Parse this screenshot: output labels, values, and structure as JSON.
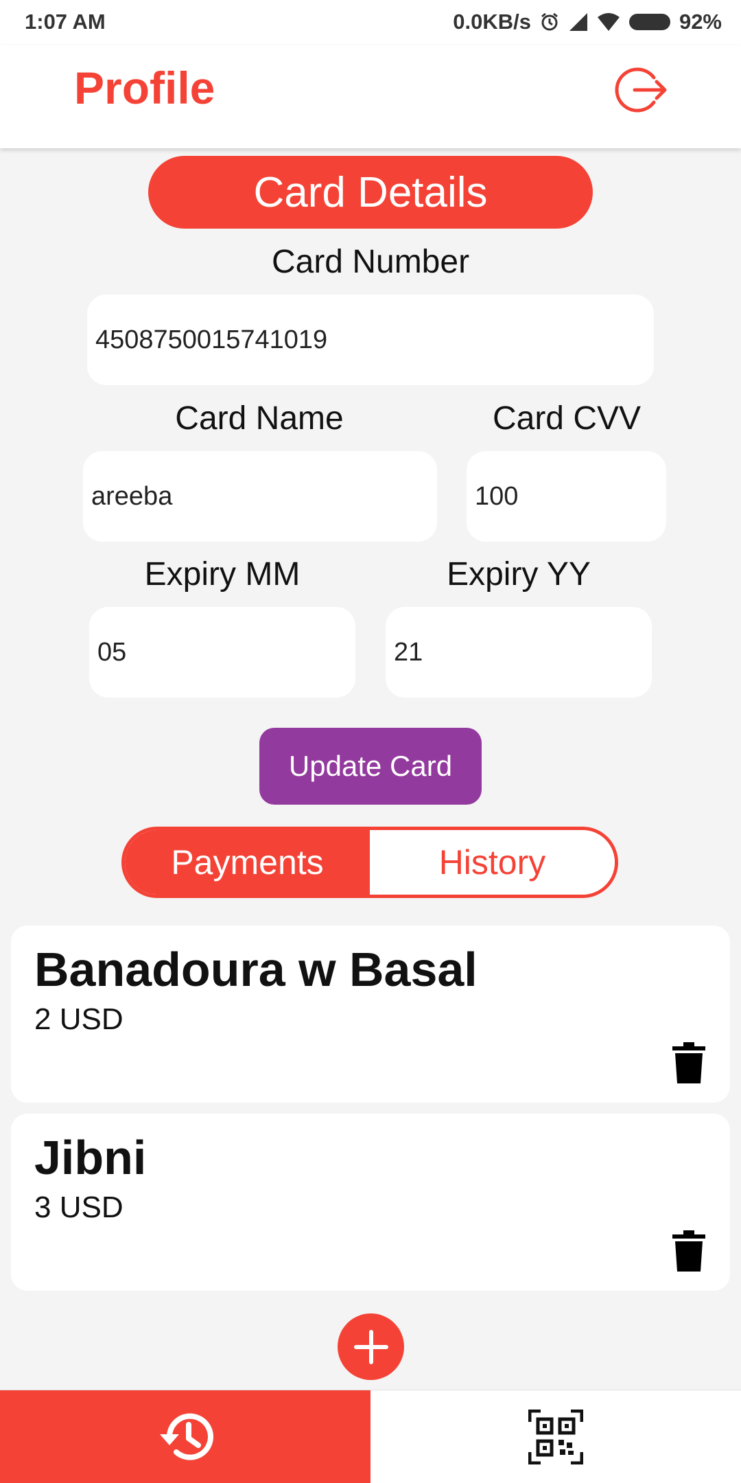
{
  "status_bar": {
    "time": "1:07 AM",
    "network_speed": "0.0KB/s",
    "battery": "92%",
    "icons": [
      "alarm-icon",
      "signal-icon",
      "wifi-icon",
      "battery-icon"
    ]
  },
  "header": {
    "title": "Profile",
    "logout_icon": "logout-icon"
  },
  "card_form": {
    "section_title": "Card Details",
    "card_number_label": "Card Number",
    "card_number_value": "4508750015741019",
    "card_name_label": "Card Name",
    "card_name_value": "areeba",
    "card_cvv_label": "Card CVV",
    "card_cvv_value": "100",
    "expiry_mm_label": "Expiry MM",
    "expiry_mm_value": "05",
    "expiry_yy_label": "Expiry YY",
    "expiry_yy_value": "21",
    "update_label": "Update Card"
  },
  "tabs": {
    "payments_label": "Payments",
    "history_label": "History",
    "active": "Payments"
  },
  "payments": [
    {
      "name": "Banadoura w Basal",
      "amount": "2 USD"
    },
    {
      "name": "Jibni",
      "amount": "3 USD"
    }
  ],
  "bottom_nav": {
    "items": [
      "history-icon",
      "qr-code-icon"
    ],
    "active": "history-icon"
  },
  "colors": {
    "accent": "#f44336",
    "button_purple": "#933a9e",
    "background": "#f4f4f4"
  }
}
